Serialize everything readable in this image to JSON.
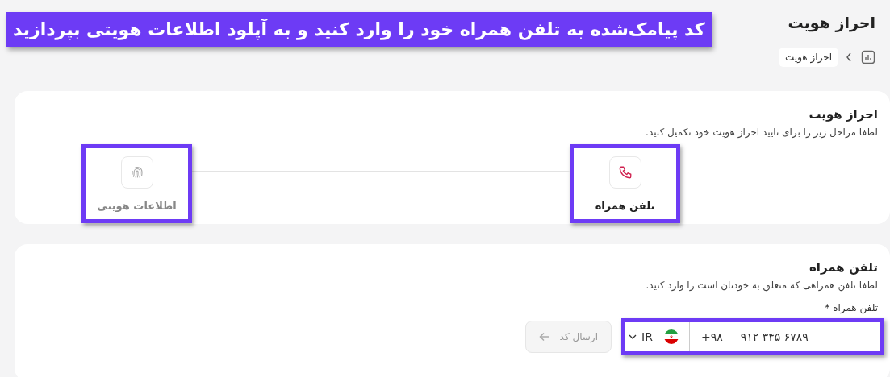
{
  "banner": {
    "text": "کد پیامک‌شده به تلفن همراه خود را وارد کنید و به آپلود اطلاعات هویتی بپردازید"
  },
  "page": {
    "title": "احراز هویت"
  },
  "breadcrumb": [
    {
      "label": "احراز هویت"
    }
  ],
  "steps_card": {
    "title": "احراز هویت",
    "subtitle": "لطفا مراحل زیر را برای تایید احراز هویت خود تکمیل کنید.",
    "steps": [
      {
        "label": "تلفن همراه",
        "kind": "phone",
        "active": true,
        "highlighted": true
      },
      {
        "label": "اطلاعات هویتی",
        "kind": "fingerprint",
        "active": false,
        "highlighted": true
      }
    ]
  },
  "phone_card": {
    "title": "تلفن همراه",
    "subtitle": "لطفا تلفن همراهی که متعلق به خودتان است را وارد کنید.",
    "field_label": "تلفن همراه *",
    "country": "IR",
    "prefix": "+۹۸",
    "value": "۹۱۲ ۳۴۵ ۶۷۸۹",
    "highlighted": true,
    "send_button": {
      "label": "ارسال کد",
      "disabled": true
    }
  }
}
